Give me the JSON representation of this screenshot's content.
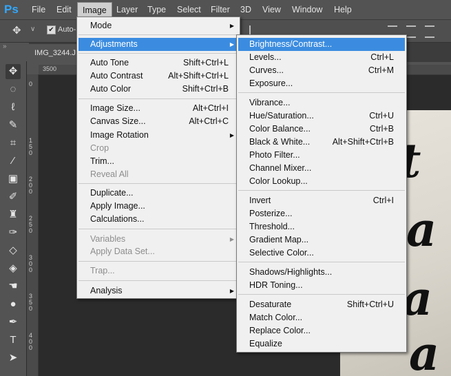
{
  "menubar": {
    "logo": "Ps",
    "items": [
      "File",
      "Edit",
      "Image",
      "Layer",
      "Type",
      "Select",
      "Filter",
      "3D",
      "View",
      "Window",
      "Help"
    ],
    "active": "Image"
  },
  "options": {
    "auto_select": "Auto-S"
  },
  "document": {
    "tab": "IMG_3244.J"
  },
  "ruler": {
    "top_label": "3500",
    "left_labels": [
      "0",
      "1",
      "5",
      "0",
      "2",
      "0",
      "0",
      "2",
      "5",
      "0",
      "3",
      "0",
      "0",
      "3",
      "5",
      "0",
      "4",
      "0",
      "0"
    ]
  },
  "image_menu": {
    "items": [
      {
        "label": "Mode",
        "shortcut": "",
        "submenu": true,
        "disabled": false
      },
      {
        "label": "Adjustments",
        "shortcut": "",
        "submenu": true,
        "disabled": false,
        "highlighted": true
      },
      {
        "label": "Auto Tone",
        "shortcut": "Shift+Ctrl+L",
        "submenu": false,
        "disabled": false
      },
      {
        "label": "Auto Contrast",
        "shortcut": "Alt+Shift+Ctrl+L",
        "submenu": false,
        "disabled": false
      },
      {
        "label": "Auto Color",
        "shortcut": "Shift+Ctrl+B",
        "submenu": false,
        "disabled": false
      },
      {
        "label": "Image Size...",
        "shortcut": "Alt+Ctrl+I",
        "submenu": false,
        "disabled": false
      },
      {
        "label": "Canvas Size...",
        "shortcut": "Alt+Ctrl+C",
        "submenu": false,
        "disabled": false
      },
      {
        "label": "Image Rotation",
        "shortcut": "",
        "submenu": true,
        "disabled": false
      },
      {
        "label": "Crop",
        "shortcut": "",
        "submenu": false,
        "disabled": true
      },
      {
        "label": "Trim...",
        "shortcut": "",
        "submenu": false,
        "disabled": false
      },
      {
        "label": "Reveal All",
        "shortcut": "",
        "submenu": false,
        "disabled": true
      },
      {
        "label": "Duplicate...",
        "shortcut": "",
        "submenu": false,
        "disabled": false
      },
      {
        "label": "Apply Image...",
        "shortcut": "",
        "submenu": false,
        "disabled": false
      },
      {
        "label": "Calculations...",
        "shortcut": "",
        "submenu": false,
        "disabled": false
      },
      {
        "label": "Variables",
        "shortcut": "",
        "submenu": true,
        "disabled": true
      },
      {
        "label": "Apply Data Set...",
        "shortcut": "",
        "submenu": false,
        "disabled": true
      },
      {
        "label": "Trap...",
        "shortcut": "",
        "submenu": false,
        "disabled": true
      },
      {
        "label": "Analysis",
        "shortcut": "",
        "submenu": true,
        "disabled": false
      }
    ]
  },
  "adjustments_menu": {
    "items": [
      {
        "label": "Brightness/Contrast...",
        "shortcut": "",
        "highlighted": true
      },
      {
        "label": "Levels...",
        "shortcut": "Ctrl+L"
      },
      {
        "label": "Curves...",
        "shortcut": "Ctrl+M"
      },
      {
        "label": "Exposure...",
        "shortcut": ""
      },
      {
        "label": "Vibrance...",
        "shortcut": ""
      },
      {
        "label": "Hue/Saturation...",
        "shortcut": "Ctrl+U"
      },
      {
        "label": "Color Balance...",
        "shortcut": "Ctrl+B"
      },
      {
        "label": "Black & White...",
        "shortcut": "Alt+Shift+Ctrl+B"
      },
      {
        "label": "Photo Filter...",
        "shortcut": ""
      },
      {
        "label": "Channel Mixer...",
        "shortcut": ""
      },
      {
        "label": "Color Lookup...",
        "shortcut": ""
      },
      {
        "label": "Invert",
        "shortcut": "Ctrl+I"
      },
      {
        "label": "Posterize...",
        "shortcut": ""
      },
      {
        "label": "Threshold...",
        "shortcut": ""
      },
      {
        "label": "Gradient Map...",
        "shortcut": ""
      },
      {
        "label": "Selective Color...",
        "shortcut": ""
      },
      {
        "label": "Shadows/Highlights...",
        "shortcut": ""
      },
      {
        "label": "HDR Toning...",
        "shortcut": ""
      },
      {
        "label": "Desaturate",
        "shortcut": "Shift+Ctrl+U"
      },
      {
        "label": "Match Color...",
        "shortcut": ""
      },
      {
        "label": "Replace Color...",
        "shortcut": ""
      },
      {
        "label": "Equalize",
        "shortcut": ""
      }
    ]
  },
  "tools": [
    "move-tool",
    "marquee-tool",
    "lasso-tool",
    "quick-select-tool",
    "crop-tool",
    "eyedropper-tool",
    "healing-tool",
    "brush-tool",
    "stamp-tool",
    "history-brush-tool",
    "eraser-tool",
    "paint-bucket-tool",
    "smudge-tool",
    "dodge-tool",
    "pen-tool",
    "type-tool",
    "path-select-tool"
  ],
  "colors": {
    "highlight": "#3b8ce0",
    "menu_bg": "#f0f0f0",
    "ui_bg": "#535353",
    "ps_blue": "#31a8ff"
  }
}
